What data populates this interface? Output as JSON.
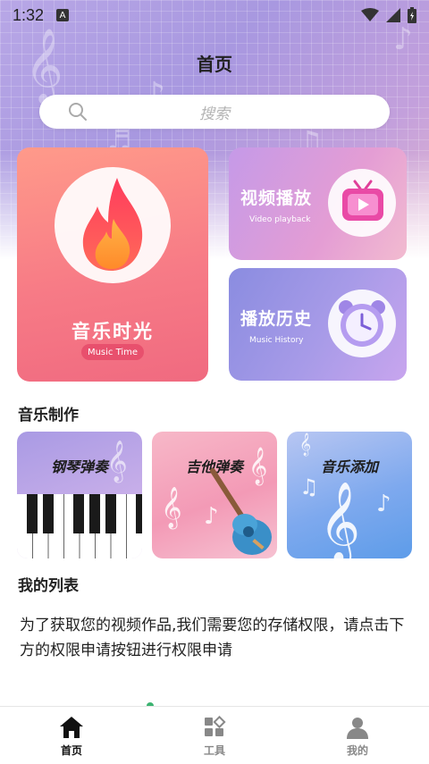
{
  "status_bar": {
    "time": "1:32",
    "notification_badge": "A"
  },
  "header": {
    "title": "首页"
  },
  "search": {
    "placeholder": "搜索"
  },
  "feature_cards": {
    "music_time": {
      "title": "音乐时光",
      "subtitle": "Music Time"
    },
    "video_playback": {
      "title": "视频播放",
      "subtitle": "Video playback"
    },
    "play_history": {
      "title": "播放历史",
      "subtitle": "Music History"
    }
  },
  "music_making": {
    "section_title": "音乐制作",
    "tiles": [
      {
        "label": "钢琴弹奏",
        "icon": "piano-keys"
      },
      {
        "label": "吉他弹奏",
        "icon": "guitar"
      },
      {
        "label": "音乐添加",
        "icon": "treble-clef"
      }
    ]
  },
  "my_list": {
    "section_title": "我的列表",
    "permission_message": "为了获取您的视频作品,我们需要您的存储权限，请点击下方的权限申请按钮进行权限申请"
  },
  "bottom_nav": {
    "items": [
      {
        "label": "首页",
        "icon": "home-icon",
        "active": true
      },
      {
        "label": "工具",
        "icon": "tools-icon",
        "active": false
      },
      {
        "label": "我的",
        "icon": "profile-icon",
        "active": false
      }
    ]
  },
  "colors": {
    "header_bg": "#a898e0",
    "music_time_card": "#f77b86",
    "video_card": "#e49dd4",
    "history_card": "#a89be8",
    "active_nav": "#111111",
    "inactive_nav": "#888888"
  }
}
